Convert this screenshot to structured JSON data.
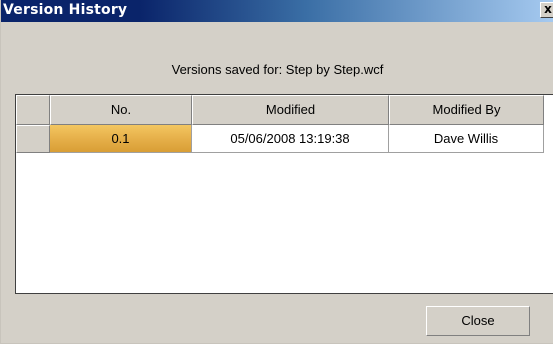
{
  "window": {
    "title": "Version History",
    "close_glyph": "x"
  },
  "header": {
    "caption": "Versions saved for: Step by Step.wcf"
  },
  "table": {
    "columns": [
      "No.",
      "Modified",
      "Modified By"
    ],
    "rows": [
      {
        "no": "0.1",
        "modified": "05/06/2008 13:19:38",
        "modified_by": "Dave Willis",
        "selected_cell": "no"
      }
    ]
  },
  "footer": {
    "close_label": "Close"
  },
  "colors": {
    "titlebar": "#0a246a",
    "dialog_bg": "#d4d0c8",
    "selected_cell": "#e6b04a"
  }
}
